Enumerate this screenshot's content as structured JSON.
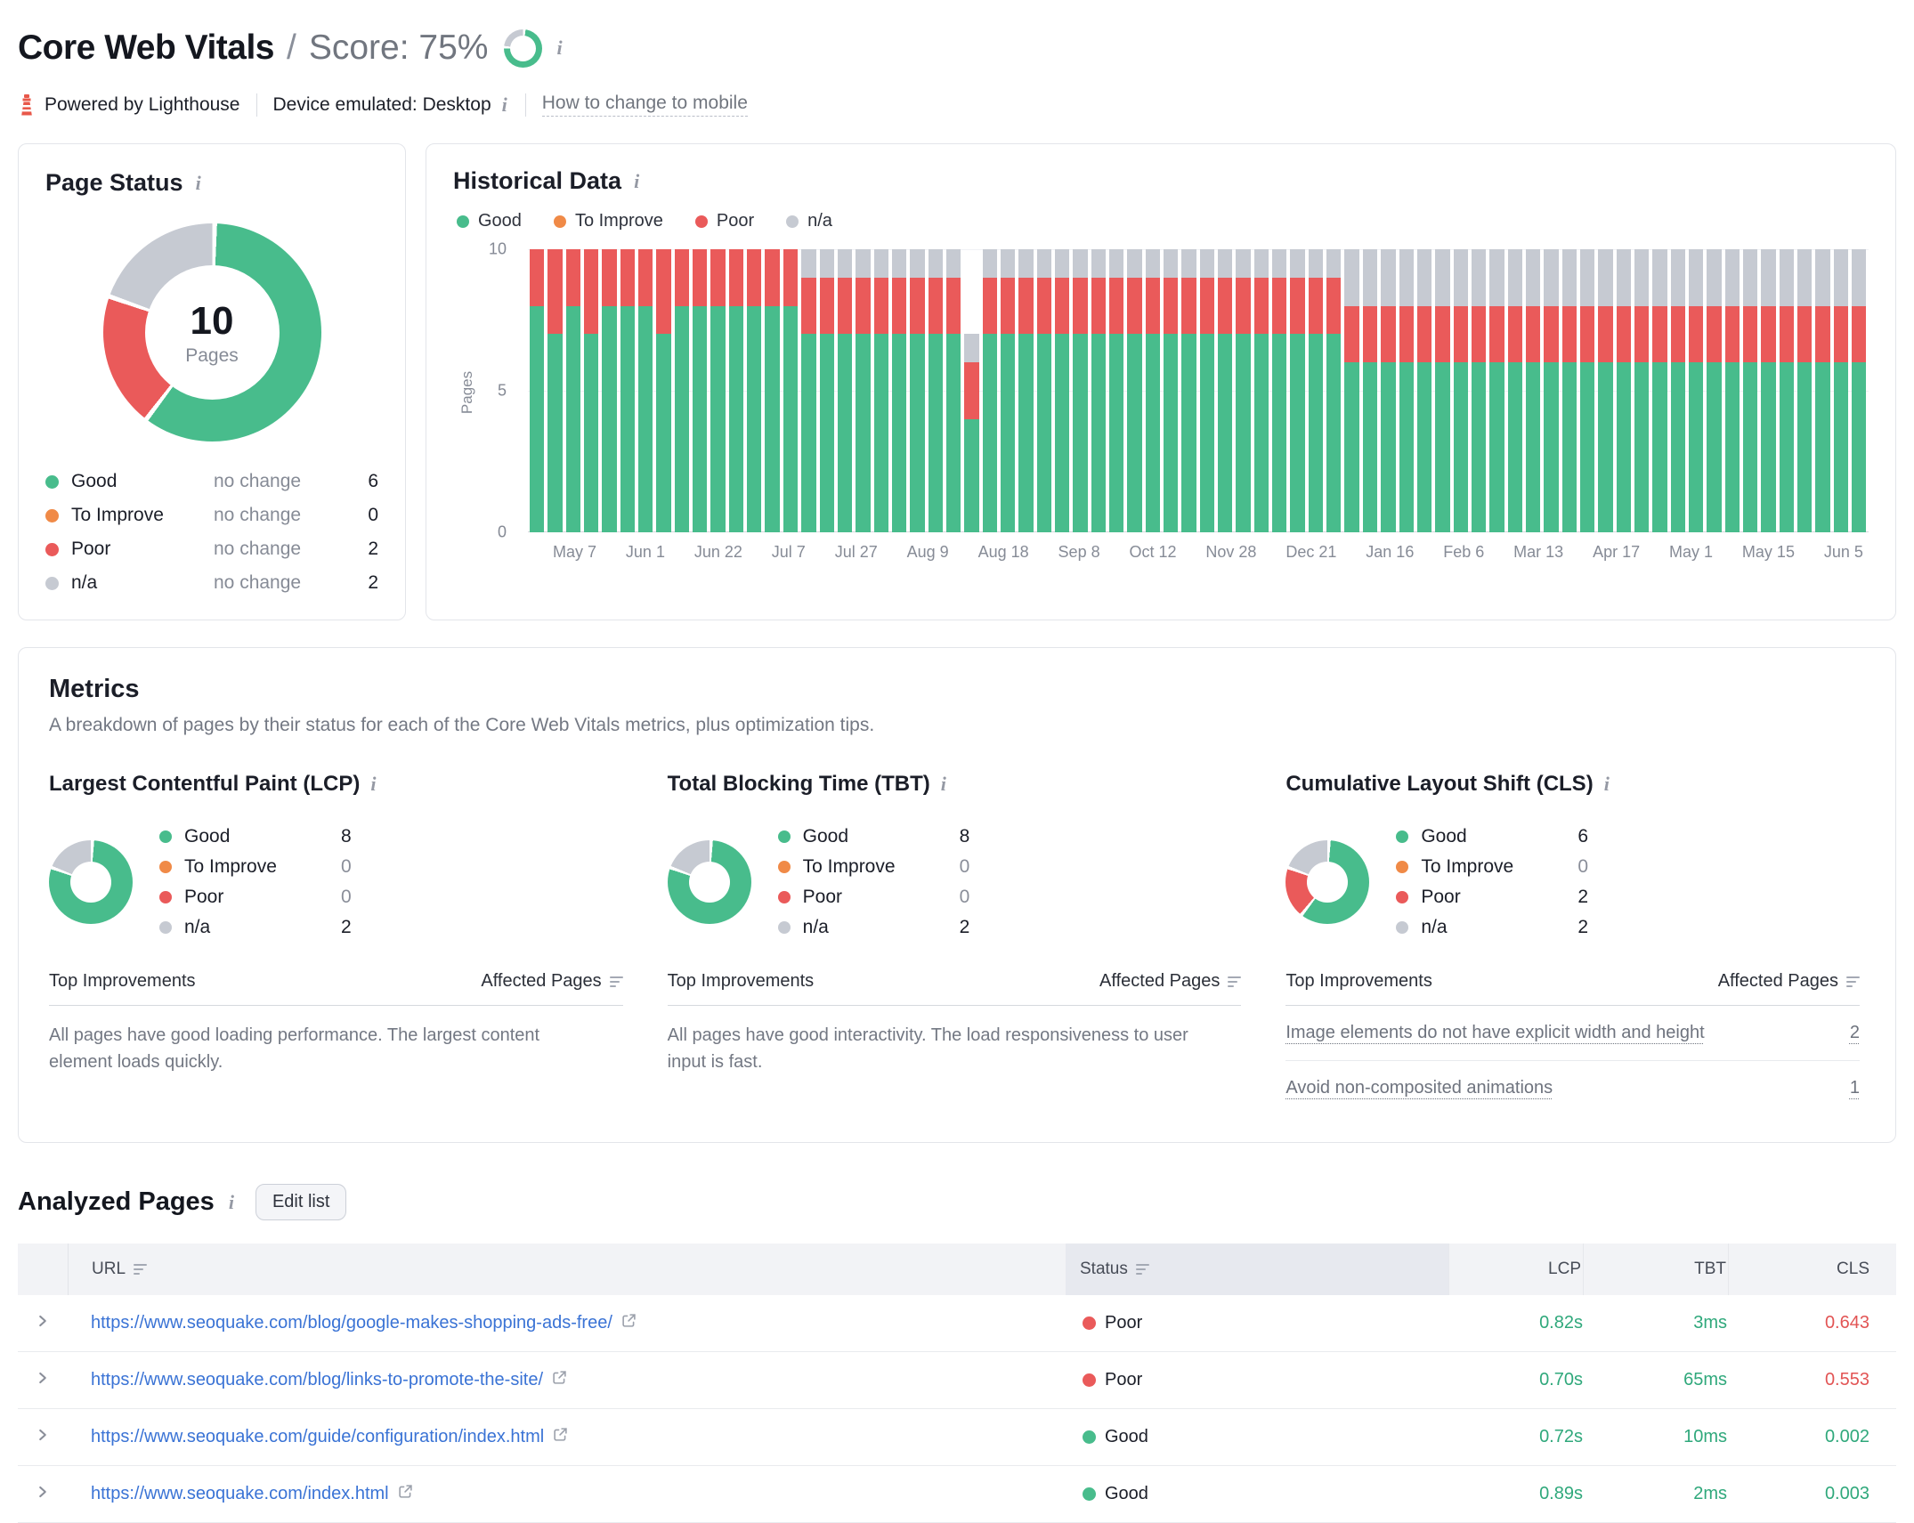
{
  "icons": {
    "info": "i"
  },
  "colors": {
    "good": "#48bc8c",
    "to_improve": "#f08a47",
    "poor": "#ea5a5a",
    "na": "#c6cad2",
    "value_good": "#2fa87b",
    "value_bad": "#e25454",
    "link_blue": "#3a73d5",
    "score_ring_green": "#48bc8c",
    "score_ring_gray": "#c6cad2"
  },
  "header": {
    "title": "Core Web Vitals",
    "separator": "/",
    "score_text": "Score: 75%",
    "score_percent": 75,
    "score_ring": [
      {
        "color": "#48bc8c",
        "pct": 75
      },
      {
        "color": "#c6cad2",
        "pct": 25
      }
    ],
    "powered_by": "Powered by Lighthouse",
    "device": "Device emulated: Desktop",
    "mobile_link": "How to change to mobile"
  },
  "page_status": {
    "title": "Page Status",
    "total": "10",
    "total_label": "Pages",
    "donut": [
      {
        "color": "#48bc8c",
        "pct": 60
      },
      {
        "color": "#ea5a5a",
        "pct": 20
      },
      {
        "color": "#c6cad2",
        "pct": 20
      }
    ],
    "legend": [
      {
        "label": "Good",
        "color": "#48bc8c",
        "change": "no change",
        "value": "6"
      },
      {
        "label": "To Improve",
        "color": "#f08a47",
        "change": "no change",
        "value": "0"
      },
      {
        "label": "Poor",
        "color": "#ea5a5a",
        "change": "no change",
        "value": "2"
      },
      {
        "label": "n/a",
        "color": "#c6cad2",
        "change": "no change",
        "value": "2"
      }
    ]
  },
  "historical": {
    "title": "Historical Data",
    "legend": [
      {
        "label": "Good",
        "color": "#48bc8c"
      },
      {
        "label": "To Improve",
        "color": "#f08a47"
      },
      {
        "label": "Poor",
        "color": "#ea5a5a"
      },
      {
        "label": "n/a",
        "color": "#c6cad2"
      }
    ],
    "chart_data": {
      "type": "bar",
      "stacked": true,
      "title": "Historical Data",
      "ylabel": "Pages",
      "ylim": [
        0,
        10
      ],
      "yticks": [
        "10",
        "5",
        "0"
      ],
      "series_order": [
        "Good",
        "Poor",
        "n/a"
      ],
      "series_colors": [
        "#48bc8c",
        "#ea5a5a",
        "#c6cad2"
      ],
      "x_tick_labels": [
        "May 7",
        "Jun 1",
        "Jun 22",
        "Jul 7",
        "Jul 27",
        "Aug 9",
        "Aug 18",
        "Sep 8",
        "Oct 12",
        "Nov 28",
        "Dec 21",
        "Jan 16",
        "Feb 6",
        "Mar 13",
        "Apr 17",
        "May 1",
        "May 15",
        "Jun 5"
      ],
      "bars": [
        [
          8,
          2,
          0
        ],
        [
          7,
          3,
          0
        ],
        [
          8,
          2,
          0
        ],
        [
          7,
          3,
          0
        ],
        [
          8,
          2,
          0
        ],
        [
          8,
          2,
          0
        ],
        [
          8,
          2,
          0
        ],
        [
          7,
          3,
          0
        ],
        [
          8,
          2,
          0
        ],
        [
          8,
          2,
          0
        ],
        [
          8,
          2,
          0
        ],
        [
          8,
          2,
          0
        ],
        [
          8,
          2,
          0
        ],
        [
          8,
          2,
          0
        ],
        [
          8,
          2,
          0
        ],
        [
          7,
          2,
          1
        ],
        [
          7,
          2,
          1
        ],
        [
          7,
          2,
          1
        ],
        [
          7,
          2,
          1
        ],
        [
          7,
          2,
          1
        ],
        [
          7,
          2,
          1
        ],
        [
          7,
          2,
          1
        ],
        [
          7,
          2,
          1
        ],
        [
          7,
          2,
          1
        ],
        [
          4,
          2,
          1
        ],
        [
          7,
          2,
          1
        ],
        [
          7,
          2,
          1
        ],
        [
          7,
          2,
          1
        ],
        [
          7,
          2,
          1
        ],
        [
          7,
          2,
          1
        ],
        [
          7,
          2,
          1
        ],
        [
          7,
          2,
          1
        ],
        [
          7,
          2,
          1
        ],
        [
          7,
          2,
          1
        ],
        [
          7,
          2,
          1
        ],
        [
          7,
          2,
          1
        ],
        [
          7,
          2,
          1
        ],
        [
          7,
          2,
          1
        ],
        [
          7,
          2,
          1
        ],
        [
          7,
          2,
          1
        ],
        [
          7,
          2,
          1
        ],
        [
          7,
          2,
          1
        ],
        [
          7,
          2,
          1
        ],
        [
          7,
          2,
          1
        ],
        [
          7,
          2,
          1
        ],
        [
          6,
          2,
          2
        ],
        [
          6,
          2,
          2
        ],
        [
          6,
          2,
          2
        ],
        [
          6,
          2,
          2
        ],
        [
          6,
          2,
          2
        ],
        [
          6,
          2,
          2
        ],
        [
          6,
          2,
          2
        ],
        [
          6,
          2,
          2
        ],
        [
          6,
          2,
          2
        ],
        [
          6,
          2,
          2
        ],
        [
          6,
          2,
          2
        ],
        [
          6,
          2,
          2
        ],
        [
          6,
          2,
          2
        ],
        [
          6,
          2,
          2
        ],
        [
          6,
          2,
          2
        ],
        [
          6,
          2,
          2
        ],
        [
          6,
          2,
          2
        ],
        [
          6,
          2,
          2
        ],
        [
          6,
          2,
          2
        ],
        [
          6,
          2,
          2
        ],
        [
          6,
          2,
          2
        ],
        [
          6,
          2,
          2
        ],
        [
          6,
          2,
          2
        ],
        [
          6,
          2,
          2
        ],
        [
          6,
          2,
          2
        ],
        [
          6,
          2,
          2
        ],
        [
          6,
          2,
          2
        ],
        [
          6,
          2,
          2
        ],
        [
          6,
          2,
          2
        ]
      ]
    }
  },
  "metrics": {
    "title": "Metrics",
    "subtitle": "A breakdown of pages by their status for each of the Core Web Vitals metrics, plus optimization tips.",
    "improvements_header": "Top Improvements",
    "affected_header": "Affected Pages",
    "cards": [
      {
        "title": "Largest Contentful Paint (LCP)",
        "donut": [
          {
            "color": "#48bc8c",
            "pct": 80
          },
          {
            "color": "#c6cad2",
            "pct": 20
          }
        ],
        "legend": [
          {
            "label": "Good",
            "color": "#48bc8c",
            "value": "8"
          },
          {
            "label": "To Improve",
            "color": "#f08a47",
            "value": "0"
          },
          {
            "label": "Poor",
            "color": "#ea5a5a",
            "value": "0"
          },
          {
            "label": "n/a",
            "color": "#c6cad2",
            "value": "2"
          }
        ],
        "note": "All pages have good loading performance. The largest content element loads quickly.",
        "improvements": []
      },
      {
        "title": "Total Blocking Time (TBT)",
        "donut": [
          {
            "color": "#48bc8c",
            "pct": 80
          },
          {
            "color": "#c6cad2",
            "pct": 20
          }
        ],
        "legend": [
          {
            "label": "Good",
            "color": "#48bc8c",
            "value": "8"
          },
          {
            "label": "To Improve",
            "color": "#f08a47",
            "value": "0"
          },
          {
            "label": "Poor",
            "color": "#ea5a5a",
            "value": "0"
          },
          {
            "label": "n/a",
            "color": "#c6cad2",
            "value": "2"
          }
        ],
        "note": "All pages have good interactivity. The load responsiveness to user input is fast.",
        "improvements": []
      },
      {
        "title": "Cumulative Layout Shift (CLS)",
        "donut": [
          {
            "color": "#48bc8c",
            "pct": 60
          },
          {
            "color": "#ea5a5a",
            "pct": 20
          },
          {
            "color": "#c6cad2",
            "pct": 20
          }
        ],
        "legend": [
          {
            "label": "Good",
            "color": "#48bc8c",
            "value": "6"
          },
          {
            "label": "To Improve",
            "color": "#f08a47",
            "value": "0"
          },
          {
            "label": "Poor",
            "color": "#ea5a5a",
            "value": "2"
          },
          {
            "label": "n/a",
            "color": "#c6cad2",
            "value": "2"
          }
        ],
        "note": "",
        "improvements": [
          {
            "label": "Image elements do not have explicit width and height",
            "pages": "2"
          },
          {
            "label": "Avoid non-composited animations",
            "pages": "1"
          }
        ]
      }
    ]
  },
  "analyzed": {
    "title": "Analyzed Pages",
    "edit_button": "Edit list",
    "columns": {
      "url": "URL",
      "status": "Status",
      "lcp": "LCP",
      "tbt": "TBT",
      "cls": "CLS"
    },
    "rows": [
      {
        "url": "https://www.seoquake.com/blog/google-makes-shopping-ads-free/",
        "status": "Poor",
        "status_color": "#ea5a5a",
        "lcp": "0.82s",
        "lcp_color": "#2fa87b",
        "tbt": "3ms",
        "tbt_color": "#2fa87b",
        "cls": "0.643",
        "cls_color": "#e25454"
      },
      {
        "url": "https://www.seoquake.com/blog/links-to-promote-the-site/",
        "status": "Poor",
        "status_color": "#ea5a5a",
        "lcp": "0.70s",
        "lcp_color": "#2fa87b",
        "tbt": "65ms",
        "tbt_color": "#2fa87b",
        "cls": "0.553",
        "cls_color": "#e25454"
      },
      {
        "url": "https://www.seoquake.com/guide/configuration/index.html",
        "status": "Good",
        "status_color": "#48bc8c",
        "lcp": "0.72s",
        "lcp_color": "#2fa87b",
        "tbt": "10ms",
        "tbt_color": "#2fa87b",
        "cls": "0.002",
        "cls_color": "#2fa87b"
      },
      {
        "url": "https://www.seoquake.com/index.html",
        "status": "Good",
        "status_color": "#48bc8c",
        "lcp": "0.89s",
        "lcp_color": "#2fa87b",
        "tbt": "2ms",
        "tbt_color": "#2fa87b",
        "cls": "0.003",
        "cls_color": "#2fa87b"
      }
    ]
  }
}
